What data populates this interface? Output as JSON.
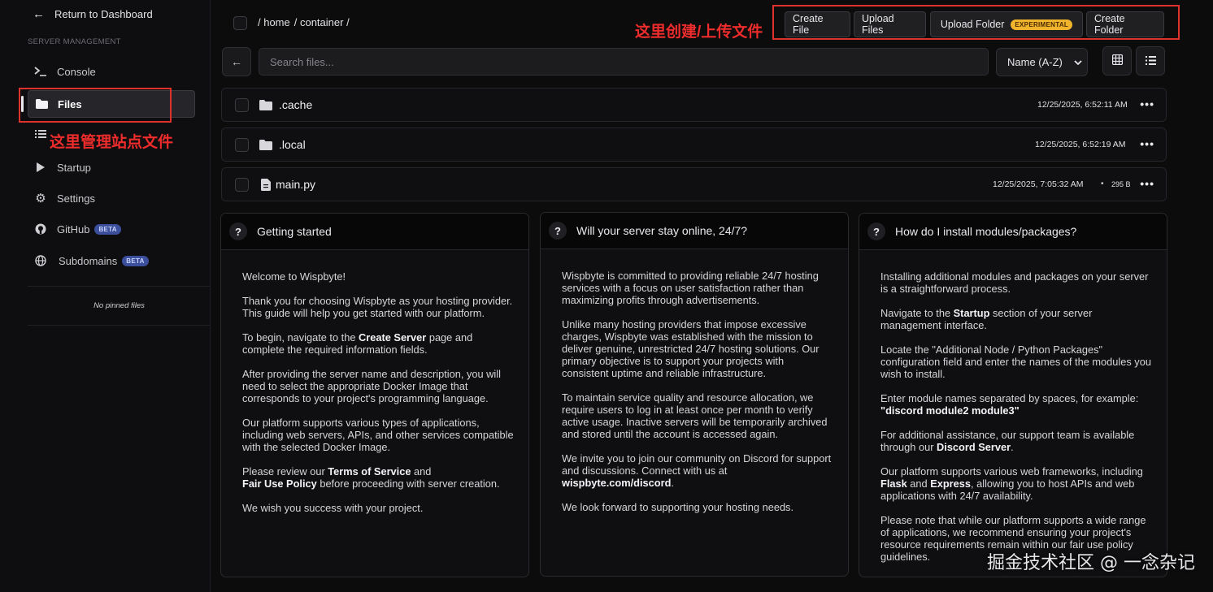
{
  "sidebar": {
    "back_label": "Return to Dashboard",
    "section_label": "SERVER MANAGEMENT",
    "items": [
      {
        "label": "Console",
        "icon": "terminal-icon"
      },
      {
        "label": "Files",
        "icon": "folder-icon",
        "active": true
      },
      {
        "label": "",
        "icon": "list-icon"
      },
      {
        "label": "Startup",
        "icon": "play-icon"
      },
      {
        "label": "Settings",
        "icon": "gear-icon"
      },
      {
        "label": "GitHub",
        "icon": "github-icon",
        "badge": "BETA"
      },
      {
        "label": "Subdomains",
        "icon": "globe-icon",
        "badge": "BETA"
      }
    ],
    "no_pinned": "No pinned files"
  },
  "annotations": {
    "left": "这里管理站点文件",
    "top": "这里创建/上传文件"
  },
  "header": {
    "breadcrumb": [
      "/ home",
      "/ container /"
    ],
    "buttons": {
      "create_file": "Create File",
      "upload_files": "Upload Files",
      "upload_folder": "Upload Folder",
      "upload_folder_badge": "EXPERIMENTAL",
      "create_folder": "Create Folder"
    }
  },
  "toolbar": {
    "search_placeholder": "Search files...",
    "sort_label": "Name (A-Z)"
  },
  "files": [
    {
      "name": ".cache",
      "type": "folder",
      "date": "12/25/2025, 6:52:11 AM",
      "size": ""
    },
    {
      "name": ".local",
      "type": "folder",
      "date": "12/25/2025, 6:52:19 AM",
      "size": ""
    },
    {
      "name": "main.py",
      "type": "file",
      "date": "12/25/2025, 7:05:32 AM",
      "size": "295 B"
    }
  ],
  "cards": [
    {
      "title": "Getting started",
      "paragraphs": [
        "Welcome to Wispbyte!",
        "Thank you for choosing Wispbyte as your hosting provider. This guide will help you get started with our platform.",
        "To begin, navigate to the <b>Create Server</b> page and complete the required information fields.",
        "After providing the server name and description, you will need to select the appropriate Docker Image that corresponds to your project's programming language.",
        "Our platform supports various types of applications, including web servers, APIs, and other services compatible with the selected Docker Image.",
        "Please review our <b>Terms of Service</b> and<br><b>Fair Use Policy</b> before proceeding with server creation.",
        "We wish you success with your project."
      ]
    },
    {
      "title": "Will your server stay online, 24/7?",
      "paragraphs": [
        "Wispbyte is committed to providing reliable 24/7 hosting services with a focus on user satisfaction rather than maximizing profits through advertisements.",
        "Unlike many hosting providers that impose excessive charges, Wispbyte was established with the mission to deliver genuine, unrestricted 24/7 hosting solutions. Our primary objective is to support your projects with consistent uptime and reliable infrastructure.",
        "To maintain service quality and resource allocation, we require users to log in at least once per month to verify active usage. Inactive servers will be temporarily archived and stored until the account is accessed again.",
        "We invite you to join our community on Discord for support and discussions. Connect with us at <b>wispbyte.com/discord</b>.",
        "We look forward to supporting your hosting needs."
      ]
    },
    {
      "title": "How do I install modules/packages?",
      "paragraphs": [
        "Installing additional modules and packages on your server is a straightforward process.",
        "Navigate to the <b>Startup</b> section of your server management interface.",
        "Locate the \"Additional Node / Python Packages\" configuration field and enter the names of the modules you wish to install.",
        "Enter module names separated by spaces, for example: <b>\"discord module2 module3\"</b>",
        "For additional assistance, our support team is available through our <b>Discord Server</b>.",
        "Our platform supports various web frameworks, including <b>Flask</b> and <b>Express</b>, allowing you to host APIs and web applications with 24/7 availability.",
        "Please note that while our platform supports a wide range of applications, we recommend ensuring your project's resource requirements remain within our fair use policy guidelines."
      ]
    }
  ],
  "watermark": "掘金技术社区 @ 一念杂记"
}
